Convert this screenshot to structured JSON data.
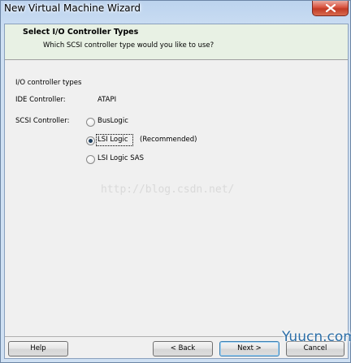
{
  "window": {
    "title": "New Virtual Machine Wizard"
  },
  "header": {
    "title": "Select I/O Controller Types",
    "subtitle": "Which SCSI controller type would you like to use?"
  },
  "group": {
    "title": "I/O controller types",
    "ide_label": "IDE Controller:",
    "ide_value": "ATAPI",
    "scsi_label": "SCSI Controller:",
    "options": [
      {
        "label": "BusLogic",
        "selected": false,
        "note": ""
      },
      {
        "label": "LSI Logic",
        "selected": true,
        "note": "(Recommended)"
      },
      {
        "label": "LSI Logic SAS",
        "selected": false,
        "note": ""
      }
    ]
  },
  "watermark": "http://blog.csdn.net/",
  "footer": {
    "help_label": "Help",
    "back_label": "< Back",
    "next_label": "Next >",
    "cancel_label": "Cancel",
    "brand": "Yuucn.com"
  },
  "colors": {
    "header_bg": "#e8f1e4",
    "client_bg": "#f0f0f0",
    "close_red": "#c13a25"
  }
}
